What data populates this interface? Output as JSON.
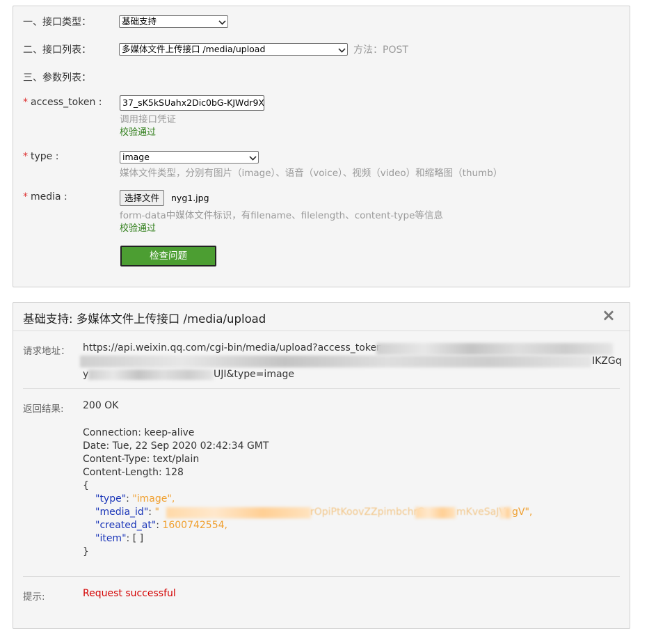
{
  "form": {
    "interface_type": {
      "label": "一、接口类型：",
      "value": "基础支持"
    },
    "interface_list": {
      "label": "二、接口列表：",
      "value": "多媒体文件上传接口 /media/upload"
    },
    "method_text": "方法：POST",
    "params_heading": "三、参数列表：",
    "access_token": {
      "required": "*",
      "label": "access_token :",
      "value": "37_sK5kSUahx2Dic0bG-KJWdr9X",
      "hint": "调用接口凭证",
      "status": "校验通过"
    },
    "type": {
      "required": "*",
      "label": "type :",
      "value": "image",
      "hint": "媒体文件类型，分别有图片（image）、语音（voice）、视频（video）和缩略图（thumb）"
    },
    "media": {
      "required": "*",
      "label": "media :",
      "file_button": "选择文件",
      "file_name": "nyg1.jpg",
      "hint": "form-data中媒体文件标识，有filename、filelength、content-type等信息",
      "status": "校验通过"
    },
    "check_button": "检查问题"
  },
  "result": {
    "title": "基础支持: 多媒体文件上传接口 /media/upload",
    "close_symbol": "×",
    "request_label": "请求地址：",
    "request_url_line1": "https://api.weixin.qq.com/cgi-bin/media/upload?access_token=",
    "request_url_line2_end": "IKZGq",
    "request_url_line3_start": "y",
    "request_url_line3_end": "UJI&type=image",
    "response_label": "返回结果:",
    "status": "200 OK",
    "headers": [
      "Connection: keep-alive",
      "Date: Tue, 22 Sep 2020 02:42:34 GMT",
      "Content-Type: text/plain",
      "Content-Length: 128"
    ],
    "json_open": "{",
    "json_close": "}",
    "json_type_key": "\"type\"",
    "json_type_value": "\"image\",",
    "json_media_id_key": "\"media_id\"",
    "json_media_id_value_start": "\"",
    "json_media_id_value_mid": "rOpiPtKoovZZpimbchrOw.",
    "json_media_id_value_end": "mKveSaJV",
    "json_media_id_value_tail": "gV\",",
    "json_created_at_key": "\"created_at\"",
    "json_created_at_value": "1600742554,",
    "json_item_key": "\"item\"",
    "json_item_value": "[ ]",
    "tip_label": "提示:",
    "tip_message": "Request successful"
  },
  "colors": {
    "button_green": "#4c9e32",
    "success_green": "#2e7d18",
    "required_red": "#d33",
    "json_key_blue": "#1a35b8",
    "json_value_orange": "#f0a030",
    "tip_red": "#d40000"
  }
}
